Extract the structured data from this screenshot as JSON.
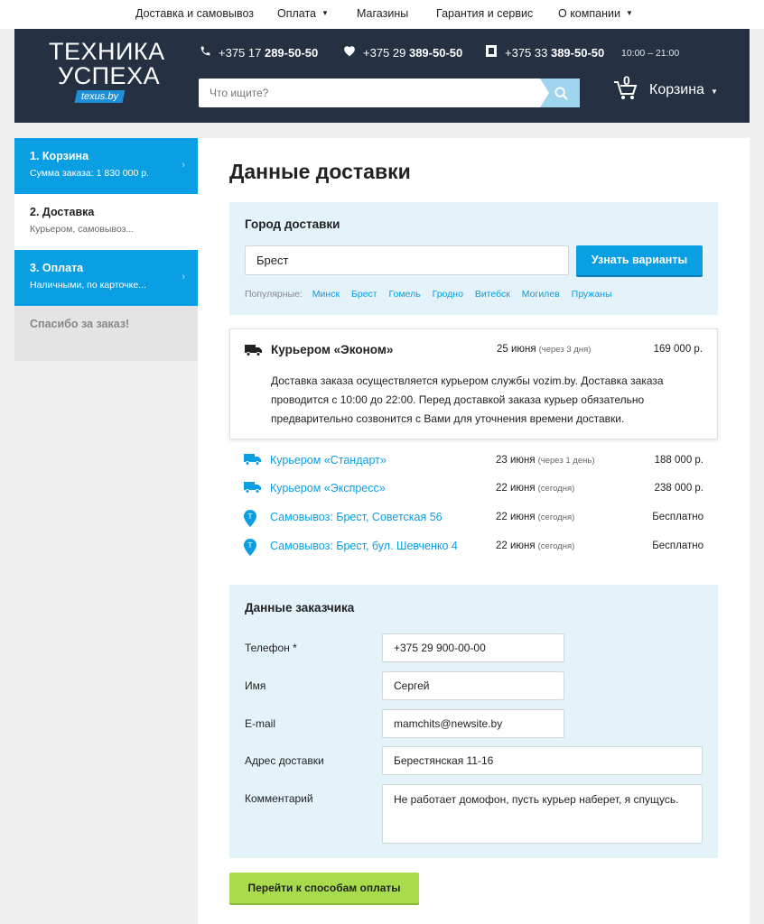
{
  "topnav": {
    "items": [
      {
        "label": "Доставка и самовывоз",
        "dropdown": false
      },
      {
        "label": "Оплата",
        "dropdown": true
      },
      {
        "label": "Магазины",
        "dropdown": false
      },
      {
        "label": "Гарантия и сервис",
        "dropdown": false
      },
      {
        "label": "О компании",
        "dropdown": true
      }
    ]
  },
  "header": {
    "logo": {
      "line1": "ТЕХНИКА",
      "line2": "УСПЕХА",
      "badge": "texus.by"
    },
    "phones": [
      {
        "icon": "phone-icon",
        "prefix": "+375 17 ",
        "number": "289-50-50"
      },
      {
        "icon": "heart-icon",
        "prefix": "+375 29 ",
        "number": "389-50-50"
      },
      {
        "icon": "square-icon",
        "prefix": "+375 33 ",
        "number": "389-50-50"
      }
    ],
    "hours": "10:00 – 21:00",
    "search_placeholder": "Что ищите?",
    "cart": {
      "count": "0",
      "label": "Корзина"
    }
  },
  "colors": {
    "header_bg": "#253142",
    "accent_blue": "#0a9ee2",
    "light_blue_panel": "#e4f2fa",
    "green_button": "#a9dc4c"
  },
  "sidebar": {
    "steps": [
      {
        "title": "1. Корзина",
        "subtitle": "Сумма заказа: 1 830 000 р.",
        "state": "done"
      },
      {
        "title": "2. Доставка",
        "subtitle": "Курьером, самовывоз...",
        "state": "current"
      },
      {
        "title": "3. Оплата",
        "subtitle": "Наличными, по карточке...",
        "state": "done"
      }
    ],
    "thanks": "Спасибо за заказ!"
  },
  "main": {
    "title": "Данные доставки",
    "city": {
      "heading": "Город доставки",
      "value": "Брест",
      "button": "Узнать варианты",
      "popular_label": "Популярные:",
      "popular": [
        "Минск",
        "Брест",
        "Гомель",
        "Гродно",
        "Витебск",
        "Могилев",
        "Пружаны"
      ]
    },
    "selected_option": {
      "icon": "truck-icon",
      "name": "Курьером «Эконом»",
      "date": "25 июня",
      "date_note": "(через 3 дня)",
      "price": "169 000 р.",
      "description": "Доставка заказа осуществляется курьером службы vozim.by. Доставка заказа проводится с 10:00 до 22:00. Перед доставкой заказа курьер обязательно предварительно созвонится с Вами для уточнения времени доставки."
    },
    "options": [
      {
        "icon": "truck-icon",
        "name": "Курьером «Стандарт»",
        "date": "23 июня",
        "date_note": "(через 1 день)",
        "price": "188 000 р."
      },
      {
        "icon": "truck-icon",
        "name": "Курьером «Экспресс»",
        "date": "22 июня",
        "date_note": "(сегодня)",
        "price": "238 000 р."
      },
      {
        "icon": "pin-icon",
        "name": "Самовывоз: Брест, Советская 56",
        "date": "22 июня",
        "date_note": "(сегодня)",
        "price": "Бесплатно"
      },
      {
        "icon": "pin-icon",
        "name": "Самовывоз: Брест, бул. Шевченко 4",
        "date": "22 июня",
        "date_note": "(сегодня)",
        "price": "Бесплатно"
      }
    ],
    "customer": {
      "heading": "Данные заказчика",
      "fields": [
        {
          "label": "Телефон *",
          "value": "+375 29 900-00-00"
        },
        {
          "label": "Имя",
          "value": "Сергей"
        },
        {
          "label": "E-mail",
          "value": "mamchits@newsite.by"
        },
        {
          "label": "Адрес доставки",
          "value": "Берестянская 11-16"
        },
        {
          "label": "Комментарий",
          "value": "Не работает домофон, пусть курьер наберет, я спущусь."
        }
      ]
    },
    "next_button": "Перейти к способам оплаты"
  }
}
